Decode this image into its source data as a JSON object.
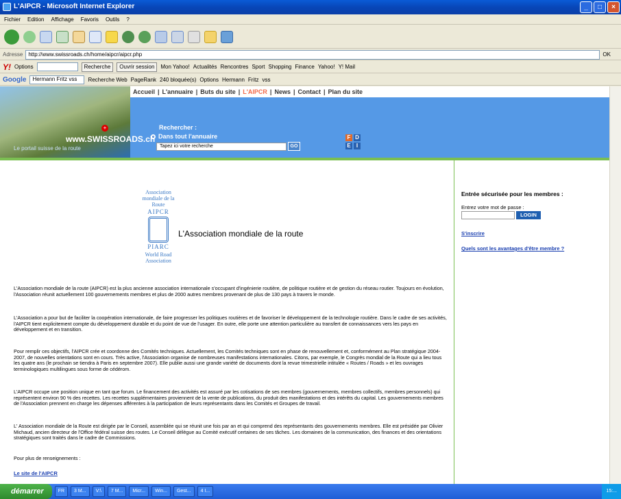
{
  "window": {
    "title": "L'AIPCR - Microsoft Internet Explorer"
  },
  "menu": [
    "Fichier",
    "Edition",
    "Affichage",
    "Favoris",
    "Outils",
    "?"
  ],
  "address": {
    "label": "Adresse",
    "url": "http://www.swissroads.ch/home/aipcr/aipcr.php",
    "go": "OK"
  },
  "yahoo_bar": {
    "options": "Options",
    "search_btn": "Recherche",
    "items": [
      "Ouvrir session",
      "Mon Yahoo!",
      "Actualités",
      "Rencontres",
      "Sport",
      "Shopping",
      "Finance",
      "Yahoo!",
      "Y! Mail"
    ]
  },
  "google_bar": {
    "logo": "Google",
    "query": "Hermann Fritz vss",
    "items": [
      "Recherche Web",
      "PageRank",
      "240 bloquée(s)",
      "Options",
      "Hermann",
      "Fritz",
      "vss"
    ]
  },
  "site": {
    "nav": [
      "Accueil",
      "L'annuaire",
      "Buts du site",
      "L'AIPCR",
      "News",
      "Contact",
      "Plan du site"
    ],
    "name": "www.SWISSROADS.ch",
    "subtitle": "Le portail suisse de la route",
    "search_title": "Rechercher :",
    "search_scope": "Dans tout l'annuaire",
    "search_placeholder": "Tapez ici votre recherche",
    "search_go": "GO",
    "langs": [
      "F",
      "D",
      "E",
      "I"
    ]
  },
  "logo": {
    "top": "Association mondiale de la Route",
    "code_fr": "AIPCR",
    "code_en": "PIARC",
    "bottom": "World Road Association"
  },
  "content": {
    "title": "L'Association mondiale de la route",
    "paragraphs": [
      "L'Association mondiale de la route (AIPCR) est la plus ancienne association internationale s'occupant d'ingénierie routière, de politique routière et de gestion du réseau routier. Toujours en évolution, l'Association réunit actuellement 100 gouvernements membres et plus de 2000 autres membres provenant de plus de 130 pays à travers le monde.",
      "L'Association a pour but de faciliter la coopération internationale, de faire progresser les politiques routières et de favoriser le développement de la technologie routière. Dans le cadre de ses activités, l'AIPCR tient explicitement compte du développement durable et du point de vue de l'usager. En outre, elle porte une attention particulière au transfert de connaissances vers les pays en développement et en transition.",
      "Pour remplir ces objectifs, l'AIPCR crée et coordonne des Comités techniques. Actuellement, les Comités techniques sont en phase de renouvellement et, conformément au Plan stratégique 2004-2007, de nouvelles orientations sont en cours. Très active, l'Association organise de nombreuses manifestations internationales. Citons, par exemple, le Congrès mondial de la Route qui a lieu tous les quatre ans (le prochain se tiendra à Paris en septembre 2007). Elle publie aussi une grande variété de documents dont la revue trimestrielle intitulée « Routes / Roads » et les ouvrages terminologiques multilingues sous forme de cédérom.",
      "L'AIPCR occupe une position unique en tant que forum. Le financement des activités est assuré par les cotisations de ses membres (gouvernements, membres collectifs, membres personnels) qui représentent environ 90 % des recettes. Les recettes supplémentaires proviennent de la vente de publications, du produit des manifestations et des intérêts du capital. Les gouvernements membres de l'Association prennent en charge les dépenses afférentes à la participation de leurs représentants dans les Comités et Groupes de travail.",
      "L' Association mondiale de la Route est dirigée par le Conseil, assemblée qui se réunit une fois par an et qui comprend des représentants des gouvernements membres. Elle est présidée par Olivier Michaud, ancien directeur de l'Office fédéral suisse des routes. Le Conseil délègue au Comité exécutif certaines de ses tâches. Les domaines de la communication, des finances et des orientations stratégiques sont traités dans le cadre de Commissions."
    ],
    "more": "Pour plus de renseignements :",
    "link": "Le site de l'AIPCR"
  },
  "sidebar": {
    "title": "Entrée sécurisée pour les membres :",
    "pwd_label": "Entrez votre mot de passe :",
    "login": "LOGIN",
    "register": "S'inscrire",
    "benefits": "Quels sont les avantages d'être membre ?"
  },
  "taskbar": {
    "start": "démarrer",
    "tasks": [
      "FR",
      "3 M...",
      "V:\\",
      "7 M...",
      "Micr...",
      "Win...",
      "Gest...",
      "4 I..."
    ],
    "clock": "15:..."
  }
}
